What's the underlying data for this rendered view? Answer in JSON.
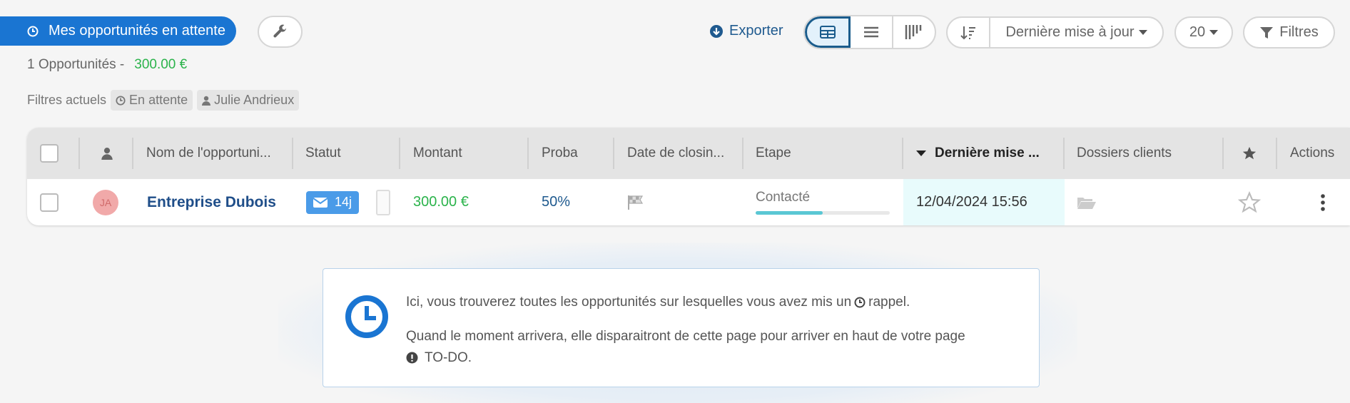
{
  "topbar": {
    "my_opps_label": "Mes opportunités en attente",
    "export_label": "Exporter",
    "sort_label": "Dernière mise à jour",
    "per_page": "20",
    "filters_label": "Filtres"
  },
  "summary": {
    "count_text": "1  Opportunités -",
    "amount": "300.00 €"
  },
  "current_filters": {
    "label": "Filtres actuels",
    "chips": [
      "En attente",
      "Julie Andrieux"
    ]
  },
  "table": {
    "headers": {
      "name": "Nom de l'opportuni...",
      "status": "Statut",
      "amount": "Montant",
      "proba": "Proba",
      "closing": "Date de closin...",
      "stage": "Etape",
      "updated": "Dernière mise ...",
      "folders": "Dossiers clients",
      "actions": "Actions"
    },
    "rows": [
      {
        "avatar": "JA",
        "name": "Entreprise Dubois",
        "status_badge": "14j",
        "amount": "300.00 €",
        "proba": "50%",
        "stage": "Contacté",
        "stage_progress": 0.5,
        "updated": "12/04/2024 15:56"
      }
    ]
  },
  "info": {
    "line1_before": "Ici, vous trouverez toutes les opportunités sur lesquelles vous avez mis un",
    "line1_after": "rappel.",
    "line2_before": "Quand le moment arrivera, elle disparaitront de cette page pour arriver en haut de votre page",
    "line2_after": "TO-DO."
  },
  "colors": {
    "accent": "#1a75d2",
    "amount_green": "#2bb34b",
    "name_blue": "#1f4e89",
    "sorted_col_bg": "#e8fbfc"
  }
}
